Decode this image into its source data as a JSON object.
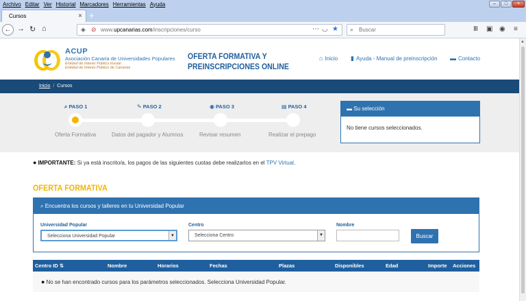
{
  "browser": {
    "menu": [
      "Archivo",
      "Editar",
      "Ver",
      "Historial",
      "Marcadores",
      "Herramientas",
      "Ayuda"
    ],
    "tab_title": "Cursos",
    "tab_close": "×",
    "new_tab": "+",
    "url_prefix": "www.",
    "url_domain": "upcanarias.com",
    "url_path": "/inscripciones/curso",
    "search_placeholder": "Buscar",
    "icons": [
      "back-icon",
      "forward-icon",
      "reload-icon",
      "home-icon",
      "shield-icon",
      "lock-icon",
      "more-icon",
      "pocket-icon",
      "bookmark-star-icon",
      "library-icon",
      "sidebar-icon",
      "account-icon",
      "menu-icon"
    ]
  },
  "header": {
    "acup_name": "ACUP",
    "acup_full": "Asociación Canaria de Universidades Populares",
    "acup_line1": "Entidad de Interés Público Insular",
    "acup_line2": "Entidad de Interés Público de Canarias",
    "title_line1": "OFERTA FORMATIVA Y",
    "title_line2": "PREINSCRIPCIONES ONLINE",
    "nav": [
      {
        "label": "Inicio",
        "icon": "home-icon"
      },
      {
        "label": "Ayuda - Manual de preinscripción",
        "icon": "book-icon"
      },
      {
        "label": "Contacto",
        "icon": "chat-icon"
      }
    ]
  },
  "breadcrumb": {
    "home": "Inicio",
    "separator": "/",
    "current": "Cursos"
  },
  "steps": [
    {
      "label": "PASO 1",
      "name": "Oferta Formativa",
      "icon": "search-icon",
      "active": true
    },
    {
      "label": "PASO 2",
      "name": "Datos del pagador y Alumnos",
      "icon": "pencil-icon",
      "active": false
    },
    {
      "label": "PASO 3",
      "name": "Revisar resumen",
      "icon": "eye-icon",
      "active": false
    },
    {
      "label": "PASO 4",
      "name": "Realizar el prepago",
      "icon": "credit-card-icon",
      "active": false
    }
  ],
  "selection": {
    "title": "Su selección",
    "empty": "No tiene cursos seleccionados."
  },
  "notice": {
    "bold": "IMPORTANTE:",
    "text": " Si ya está inscrito/a, los pagos de las siguientes cuotas debe realizarlos en el ",
    "link": "TPV Virtual",
    "end": "."
  },
  "section_title": "OFERTA FORMATIVA",
  "filter": {
    "header": "Encuentra los cursos y talleres en tu Universidad Popular",
    "up_label": "Universidad Popular",
    "up_value": "Selecciona Universidad Popular",
    "centro_label": "Centro",
    "centro_value": "Selecciona Centro",
    "nombre_label": "Nombre",
    "nombre_value": "",
    "button": "Buscar"
  },
  "table": {
    "columns": [
      "Centro ID",
      "Nombre",
      "Horarios",
      "Fechas",
      "Plazas",
      "Disponibles",
      "Edad",
      "Importe",
      "Acciones"
    ],
    "empty_message": "No se han encontrado cursos para los parámetros seleccionados. Selecciona Universidad Popular."
  },
  "colors": {
    "primary": "#2f72b0",
    "dark": "#1a4a78",
    "accent": "#f5b400"
  }
}
